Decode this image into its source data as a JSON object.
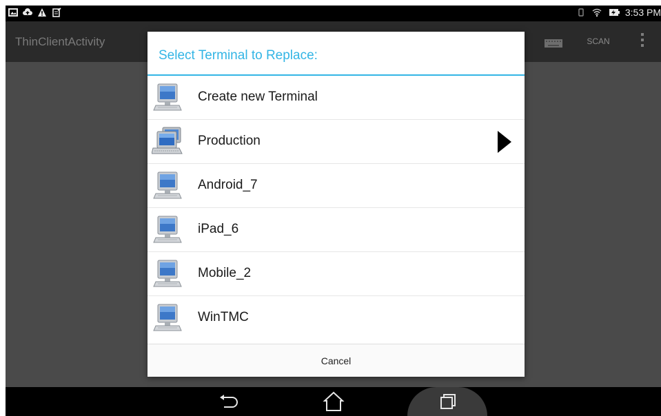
{
  "status_bar": {
    "time": "3:53 PM",
    "left_icons": [
      "gallery-icon",
      "cloud-upload-icon",
      "warning-icon",
      "clipboard-icon"
    ],
    "right_icons": [
      "vibrate-icon",
      "wifi-icon",
      "battery-charging-icon"
    ]
  },
  "action_bar": {
    "title": "ThinClientActivity",
    "scan_label": "SCAN",
    "icons": [
      "keyboard-icon",
      "overflow-menu-icon"
    ]
  },
  "dialog": {
    "title": "Select Terminal to Replace:",
    "accent_color": "#33b5e5",
    "items": [
      {
        "label": "Create new Terminal",
        "icon": "terminal-icon",
        "has_submenu": false
      },
      {
        "label": "Production",
        "icon": "terminal-group-icon",
        "has_submenu": true
      },
      {
        "label": "Android_7",
        "icon": "terminal-icon",
        "has_submenu": false
      },
      {
        "label": "iPad_6",
        "icon": "terminal-icon",
        "has_submenu": false
      },
      {
        "label": "Mobile_2",
        "icon": "terminal-icon",
        "has_submenu": false
      },
      {
        "label": "WinTMC",
        "icon": "terminal-icon",
        "has_submenu": false
      }
    ],
    "cancel_label": "Cancel"
  },
  "nav_bar": {
    "buttons": [
      "back-icon",
      "home-icon",
      "recent-apps-icon"
    ]
  }
}
